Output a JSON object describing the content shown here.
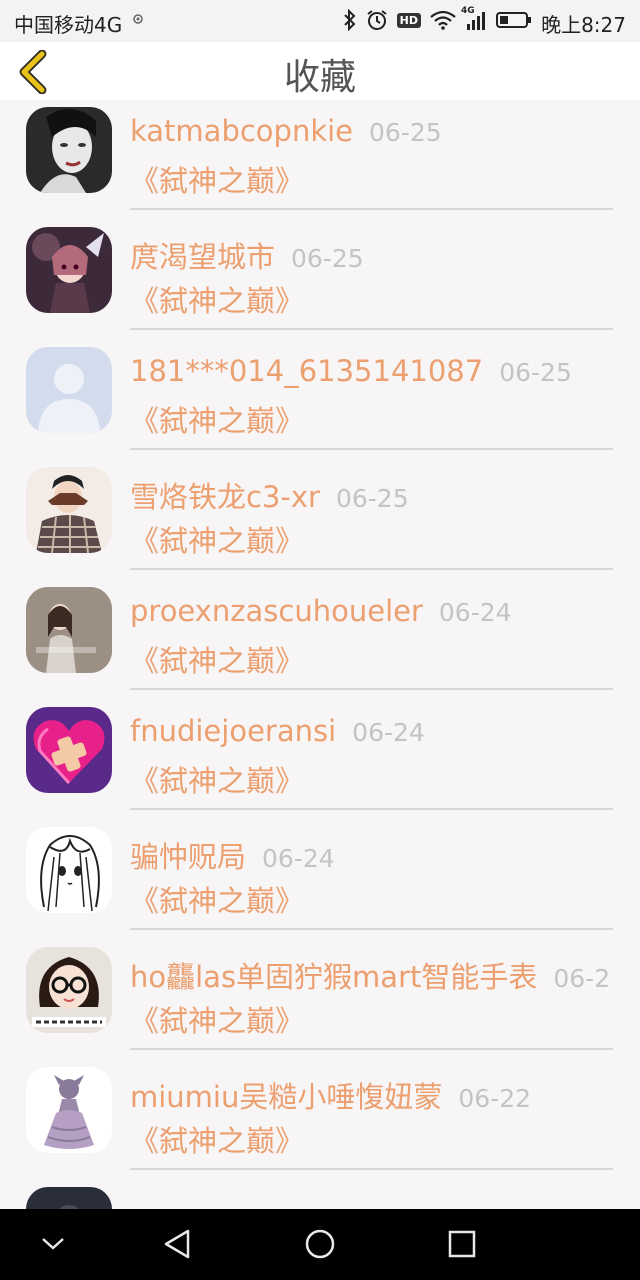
{
  "status_bar": {
    "carrier": "中国移动4G",
    "carrier_icon": "hd-call-icon",
    "network_label": "4G",
    "hd_label": "HD",
    "time": "晚上8:27",
    "icons": [
      "bluetooth-icon",
      "alarm-icon",
      "hd-icon",
      "wifi-icon",
      "signal-icon",
      "battery-icon"
    ]
  },
  "header": {
    "title": "收藏",
    "back_icon": "chevron-left-icon",
    "accent_color": "#e8c51a"
  },
  "colors": {
    "name": "#ec9f6f",
    "date": "#c4c4c4",
    "divider": "#d8d6d7"
  },
  "items": [
    {
      "name": "katmabcopnkie",
      "date": "06-25",
      "book": "《弑神之巅》",
      "avatar": "avatar-bw-portrait"
    },
    {
      "name": "庹渴望城市",
      "date": "06-25",
      "book": "《弑神之巅》",
      "avatar": "avatar-anime-girl"
    },
    {
      "name": "181***014_6135141087",
      "date": "06-25",
      "book": "《弑神之巅》",
      "avatar": "avatar-default-placeholder"
    },
    {
      "name": "雪烙铁龙c3-xr",
      "date": "06-25",
      "book": "《弑神之巅》",
      "avatar": "avatar-plaid-person"
    },
    {
      "name": "proexnzascuhoueler",
      "date": "06-24",
      "book": "《弑神之巅》",
      "avatar": "avatar-girl-photo"
    },
    {
      "name": "fnudiejoeransi",
      "date": "06-24",
      "book": "《弑神之巅》",
      "avatar": "avatar-pink-heart"
    },
    {
      "name": "骗忡贶局",
      "date": "06-24",
      "book": "《弑神之巅》",
      "avatar": "avatar-manga-sketch"
    },
    {
      "name": "ho龘las单固狞猳mart智能手表",
      "date": "06-2",
      "book": "《弑神之巅》",
      "avatar": "avatar-glasses-girl"
    },
    {
      "name": "miumiu吴糙小唾愎妞蒙",
      "date": "06-22",
      "book": "《弑神之巅》",
      "avatar": "avatar-dress-figure"
    },
    {
      "name": "",
      "date": "",
      "book": "",
      "avatar": "avatar-dark-partial"
    }
  ],
  "nav_bar": {
    "buttons": [
      "chevron-down-icon",
      "back-triangle-icon",
      "home-circle-icon",
      "recents-square-icon"
    ]
  }
}
